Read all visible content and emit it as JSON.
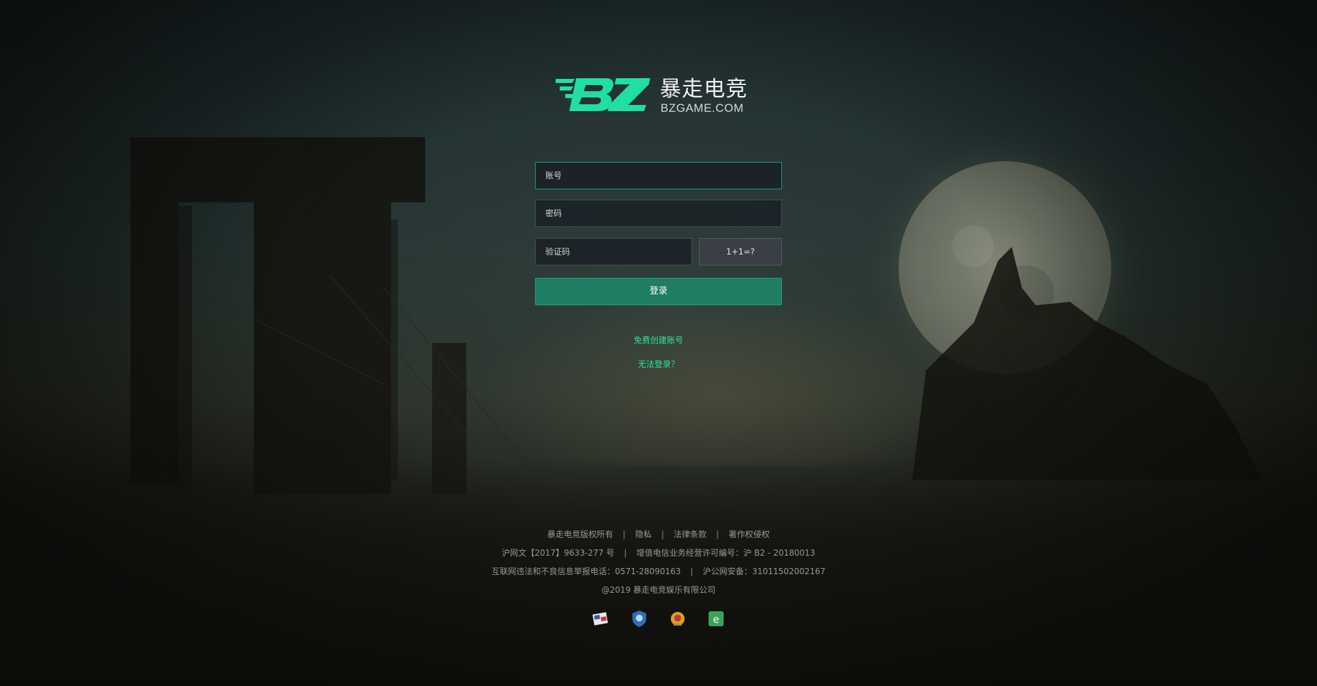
{
  "logo": {
    "mark": "BZ",
    "name_cn": "暴走电竞",
    "domain": "BZGAME.COM",
    "accent_color": "#1fe0a0"
  },
  "form": {
    "account_placeholder": "账号",
    "password_placeholder": "密码",
    "captcha_placeholder": "验证码",
    "captcha_question": "1+1=?",
    "login_label": "登录",
    "register_link": "免费创建账号",
    "help_link": "无法登录？"
  },
  "footer": {
    "row1": [
      "暴走电竞版权所有",
      "隐私",
      "法律条款",
      "著作权侵权"
    ],
    "row2": [
      "沪网文【2017】9633-277 号",
      "增值电信业务经营许可编号：沪 B2 - 20180013"
    ],
    "row3": [
      "互联网违法和不良信息举报电话：0571-28090163",
      "沪公网安备：31011502002167"
    ],
    "row4": "@2019 暴走电竞娱乐有限公司",
    "badges": [
      "network-culture-badge-icon",
      "police-shield-badge-icon",
      "public-security-badge-icon",
      "e-license-badge-icon"
    ]
  },
  "colors": {
    "primary_button": "#1e7d63",
    "link": "#2fe39a",
    "input_focus_border": "#1f9c75"
  }
}
